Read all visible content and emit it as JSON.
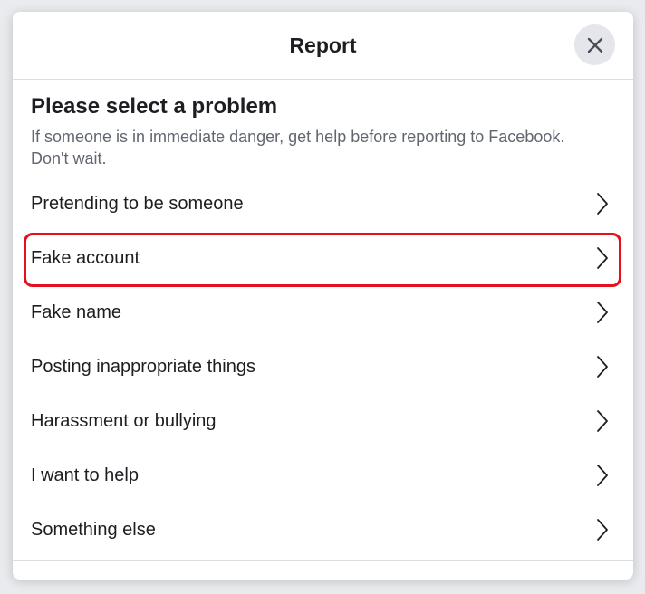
{
  "dialog": {
    "title": "Report",
    "close_icon": "close-icon"
  },
  "main": {
    "heading": "Please select a problem",
    "subtext": "If someone is in immediate danger, get help before reporting to Facebook. Don't wait.",
    "items": [
      {
        "label": "Pretending to be someone"
      },
      {
        "label": "Fake account",
        "highlighted": true
      },
      {
        "label": "Fake name"
      },
      {
        "label": "Posting inappropriate things"
      },
      {
        "label": "Harassment or bullying"
      },
      {
        "label": "I want to help"
      },
      {
        "label": "Something else"
      }
    ]
  },
  "colors": {
    "highlight": "#e5101d",
    "text": "#1c1e21",
    "subtext": "#606770"
  }
}
